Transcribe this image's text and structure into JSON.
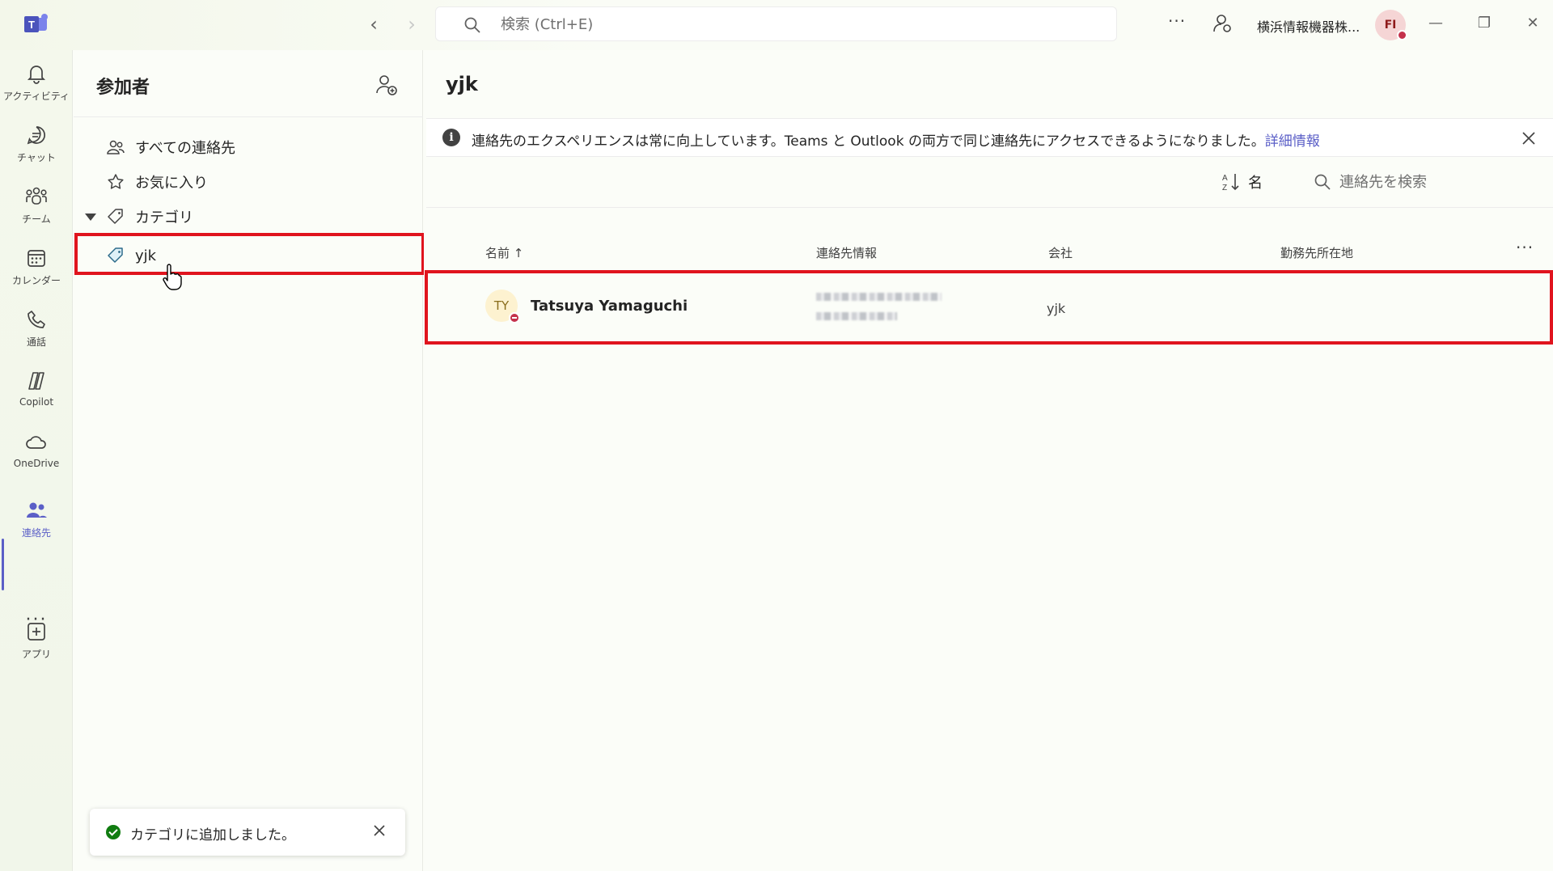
{
  "titlebar": {
    "search_placeholder": "検索 (Ctrl+E)",
    "org_name": "横浜情報機器株...",
    "user_initials": "FI",
    "more": "···"
  },
  "rail": {
    "items": [
      {
        "label": "アクティビティ",
        "icon": "bell-icon"
      },
      {
        "label": "チャット",
        "icon": "chat-icon"
      },
      {
        "label": "チーム",
        "icon": "teams-icon"
      },
      {
        "label": "カレンダー",
        "icon": "calendar-icon"
      },
      {
        "label": "通話",
        "icon": "phone-icon"
      },
      {
        "label": "Copilot",
        "icon": "copilot-icon"
      },
      {
        "label": "OneDrive",
        "icon": "cloud-icon"
      },
      {
        "label": "連絡先",
        "icon": "people-icon"
      },
      {
        "label": "アプリ",
        "icon": "add-app-icon"
      }
    ],
    "more": "···",
    "accent": "#5b5fc7"
  },
  "panel": {
    "title": "参加者",
    "items": [
      {
        "label": "すべての連絡先",
        "icon": "people-icon"
      },
      {
        "label": "お気に入り",
        "icon": "star-icon"
      },
      {
        "label": "カテゴリ",
        "icon": "tag-icon"
      },
      {
        "label": "yjk",
        "icon": "tag-icon"
      }
    ]
  },
  "toast": {
    "message": "カテゴリに追加しました。"
  },
  "main": {
    "title": "yjk",
    "banner": {
      "text": "連絡先のエクスペリエンスは常に向上しています。Teams と Outlook の両方で同じ連絡先にアクセスできるようになりました。",
      "link": "詳細情報"
    },
    "sort_label": "名",
    "search_placeholder": "連絡先を検索",
    "columns": [
      "名前 ↑",
      "連絡先情報",
      "会社",
      "勤務先所在地"
    ],
    "rows": [
      {
        "initials": "TY",
        "name": "Tatsuya Yamaguchi",
        "company": "yjk"
      }
    ]
  },
  "highlight_color": "#e0141e"
}
